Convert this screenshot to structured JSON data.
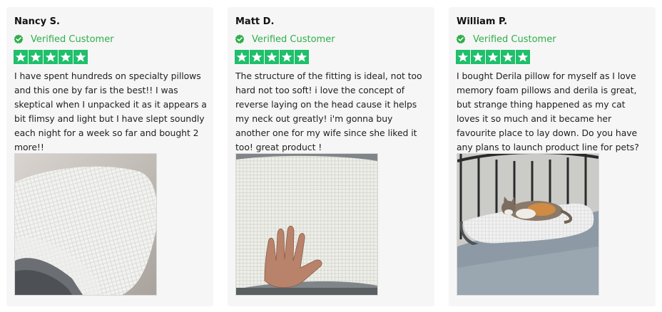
{
  "reviews": [
    {
      "name": "Nancy S.",
      "verified_label": "Verified Customer",
      "rating": 5,
      "text": "I have spent hundreds on specialty pillows and this one by far is the best!! I was skeptical when I unpacked it as it appears a bit flimsy and light but I have slept soundly each night for a week so far and bought 2 more!!",
      "photo_icon": "pillow-photo"
    },
    {
      "name": "Matt D.",
      "verified_label": "Verified Customer",
      "rating": 5,
      "text": "The structure of the fitting is ideal, not too hard not too soft! i love the concept of reverse laying on the head cause it helps my neck out greatly! i'm gonna buy another one for my wife since she liked it too! great product !",
      "photo_icon": "hand-on-pillow-photo"
    },
    {
      "name": "William P.",
      "verified_label": "Verified Customer",
      "rating": 5,
      "text": "I bought Derila pillow for myself as I love memory foam pillows and derila is great, but strange thing happened as my cat loves it so much and it became her favourite place to lay down. Do you have any plans to launch product line for pets?",
      "photo_icon": "cat-on-pillow-photo"
    }
  ],
  "colors": {
    "star_bg": "#1fbf6b",
    "verified": "#2fae4a",
    "card_bg": "#f6f6f6"
  }
}
